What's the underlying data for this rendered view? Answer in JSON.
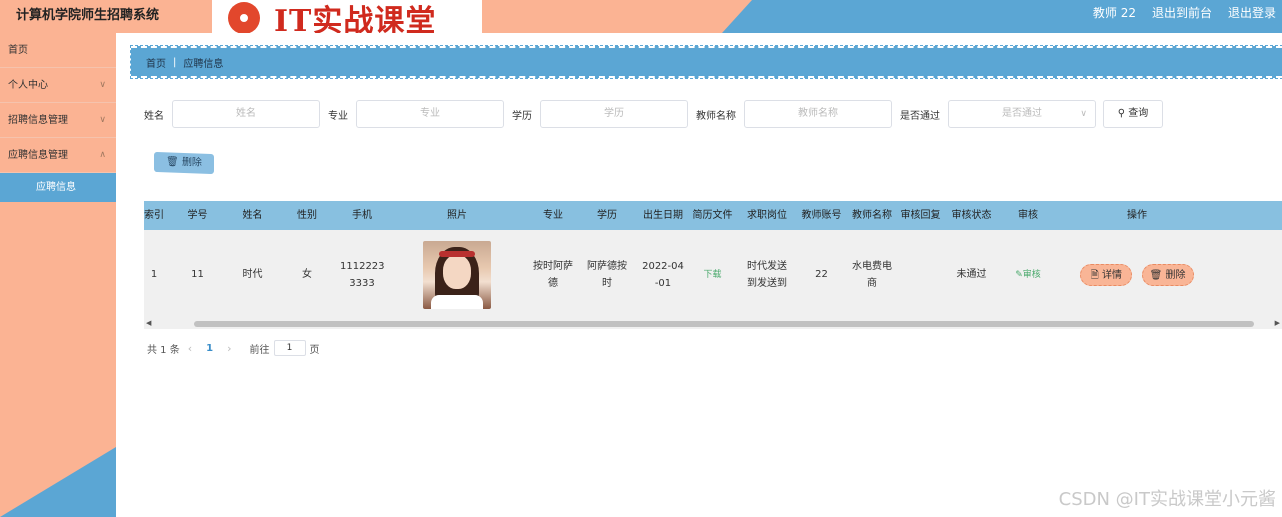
{
  "header": {
    "app_title": "计算机学院师生招聘系统",
    "logo_text": "IT实战课堂",
    "user": "教师 22",
    "to_front": "退出到前台",
    "logout": "退出登录"
  },
  "sidebar": {
    "items": [
      {
        "label": "首页"
      },
      {
        "label": "个人中心"
      },
      {
        "label": "招聘信息管理"
      },
      {
        "label": "应聘信息管理"
      }
    ],
    "active_sub": "应聘信息"
  },
  "breadcrumb": {
    "home": "首页",
    "current": "应聘信息"
  },
  "search": {
    "name_label": "姓名",
    "name_placeholder": "姓名",
    "major_label": "专业",
    "major_placeholder": "专业",
    "edu_label": "学历",
    "edu_placeholder": "学历",
    "teacher_label": "教师名称",
    "teacher_placeholder": "教师名称",
    "passed_label": "是否通过",
    "passed_placeholder": "是否通过",
    "query_button": "查询"
  },
  "actions": {
    "delete_button": "删除"
  },
  "table": {
    "headers": [
      "索引",
      "学号",
      "姓名",
      "性别",
      "手机",
      "照片",
      "专业",
      "学历",
      "出生日期",
      "简历文件",
      "求职岗位",
      "教师账号",
      "教师名称",
      "审核回复",
      "审核状态",
      "审核",
      "操作"
    ],
    "rows": [
      {
        "index": "1",
        "student_no": "11",
        "name": "时代",
        "gender": "女",
        "phone_line1": "1112223",
        "phone_line2": "3333",
        "major_line1": "按时阿萨",
        "major_line2": "德",
        "edu_line1": "阿萨德按",
        "edu_line2": "时",
        "birth_line1": "2022-04",
        "birth_line2": "-01",
        "resume": "下载",
        "position_line1": "时代发送",
        "position_line2": "到发送到",
        "teacher_account": "22",
        "teacher_name_line1": "水电费电",
        "teacher_name_line2": "商",
        "reply": "",
        "status": "未通过",
        "audit": "审核",
        "detail_button": "详情",
        "delete_button": "删除"
      }
    ]
  },
  "pager": {
    "total": "共 1 条",
    "current_page": "1",
    "goto_label": "前往",
    "goto_value": "1",
    "page_suffix": "页"
  },
  "watermark": "CSDN @IT实战课堂小元酱",
  "colors": {
    "accent_orange": "#fbb393",
    "accent_blue": "#5ba6d4",
    "header_row": "#88c0e0"
  }
}
